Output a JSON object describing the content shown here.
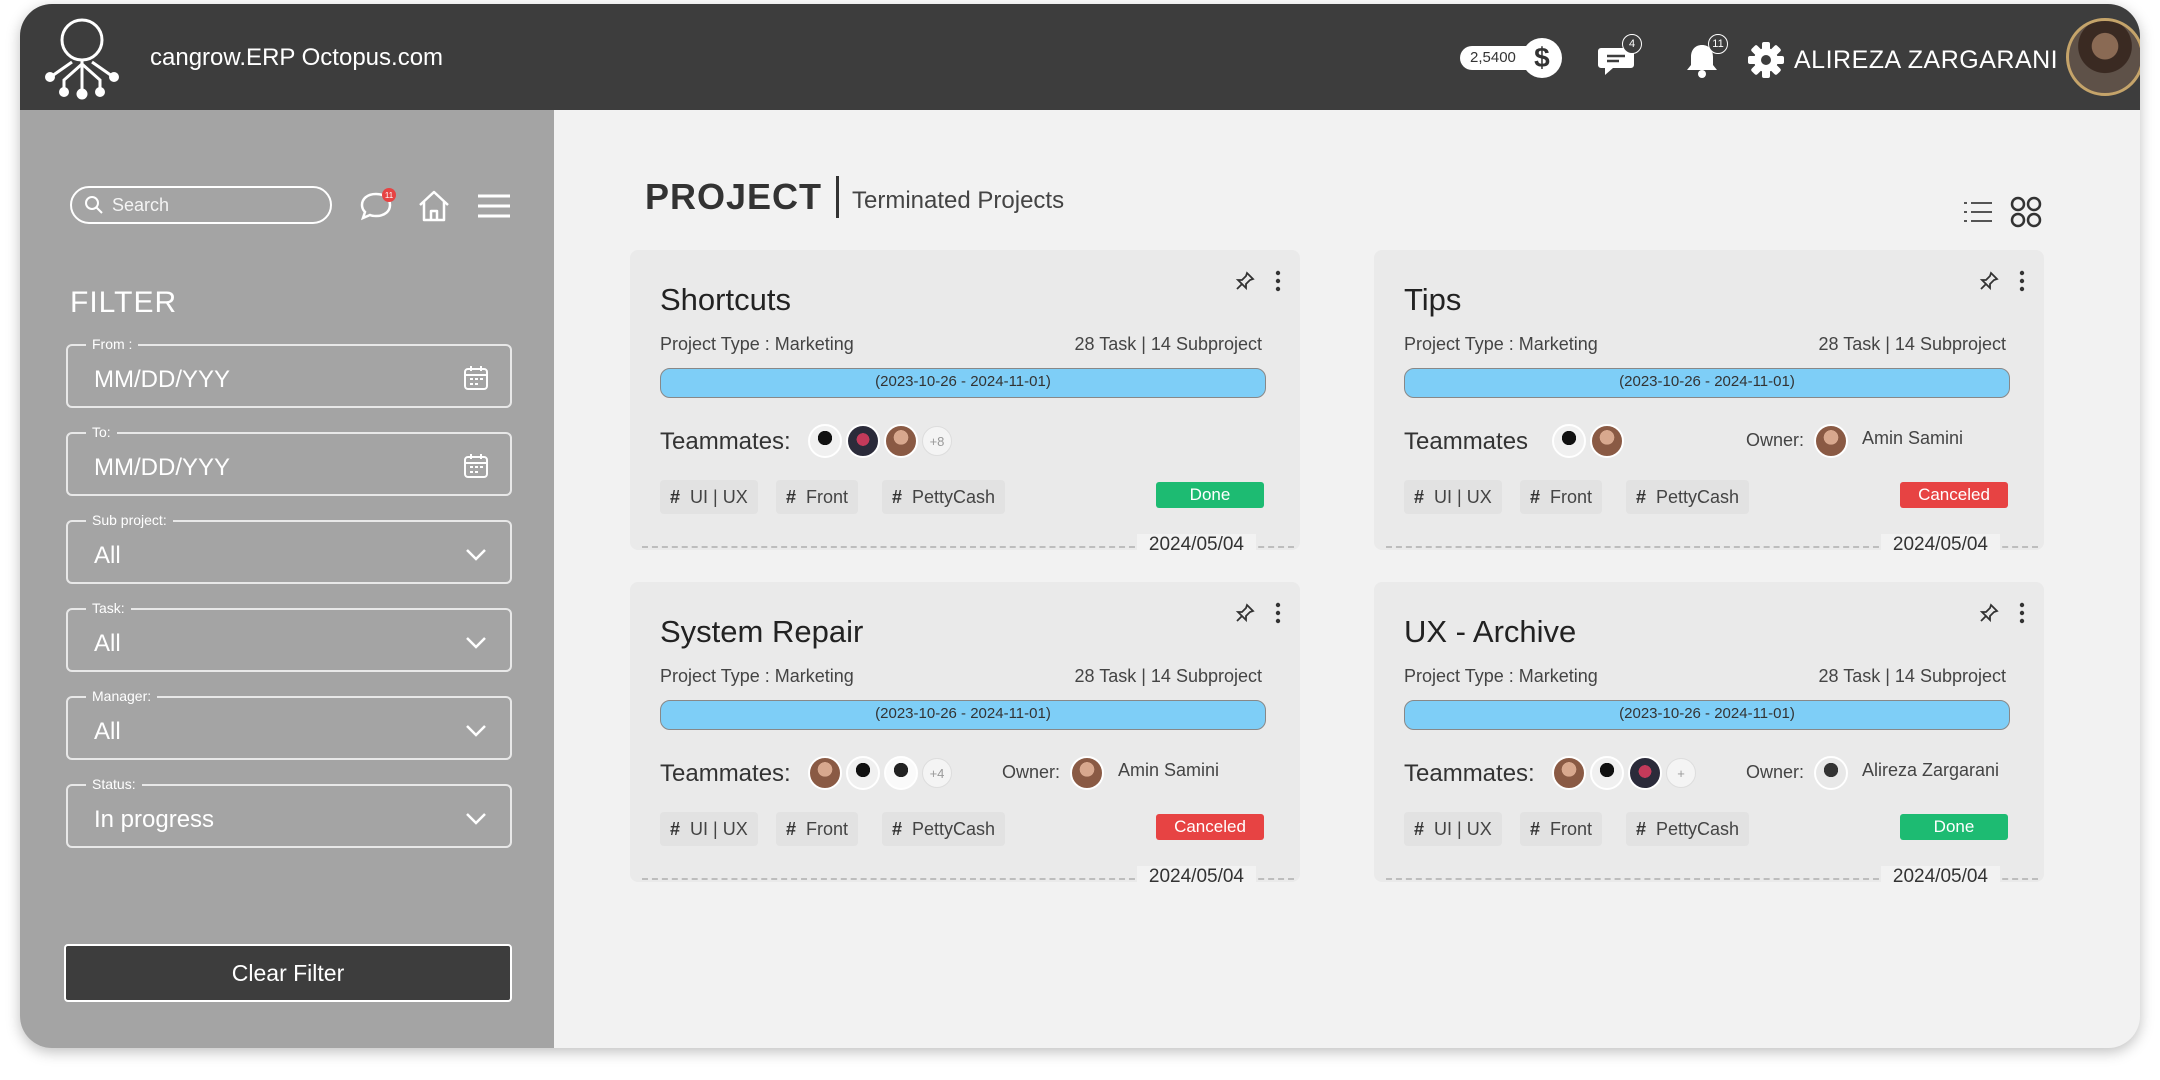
{
  "header": {
    "brand": "cangrow.ERP Octopus.com",
    "coin_balance": "2,5400",
    "coin_symbol": "$",
    "messages_count": "4",
    "notifications_count": "11",
    "username": "ALIREZA ZARGARANI"
  },
  "sidebar": {
    "search_placeholder": "Search",
    "chat_badge": "11",
    "filter_title": "FILTER",
    "fields": [
      {
        "label": "From :",
        "value": "MM/DD/YYY"
      },
      {
        "label": "To:",
        "value": "MM/DD/YYY"
      },
      {
        "label": "Sub project:",
        "value": "All"
      },
      {
        "label": "Task:",
        "value": "All"
      },
      {
        "label": "Manager:",
        "value": "All"
      },
      {
        "label": "Status:",
        "value": "In progress"
      }
    ],
    "clear_button": "Clear Filter"
  },
  "main": {
    "title": "PROJECT",
    "subtitle": "Terminated Projects",
    "cards": [
      {
        "title": "Shortcuts",
        "type": "Project Type : Marketing",
        "count": "28 Task | 14 Subproject",
        "range": "(2023-10-26 - 2024-11-01)",
        "teammates_label": "Teammates:",
        "more": "+8",
        "owner_label": "",
        "owner_name": "",
        "tags": [
          "UI | UX",
          "Front",
          "PettyCash"
        ],
        "status": "Done",
        "date": "2024/05/04"
      },
      {
        "title": "Tips",
        "type": "Project Type : Marketing",
        "count": "28 Task | 14 Subproject",
        "range": "(2023-10-26 - 2024-11-01)",
        "teammates_label": "Teammates",
        "more": "",
        "owner_label": "Owner:",
        "owner_name": "Amin Samini",
        "tags": [
          "UI | UX",
          "Front",
          "PettyCash"
        ],
        "status": "Canceled",
        "date": "2024/05/04"
      },
      {
        "title": "System Repair",
        "type": "Project Type : Marketing",
        "count": "28 Task | 14 Subproject",
        "range": "(2023-10-26 - 2024-11-01)",
        "teammates_label": "Teammates:",
        "more": "+4",
        "owner_label": "Owner:",
        "owner_name": "Amin Samini",
        "tags": [
          "UI | UX",
          "Front",
          "PettyCash"
        ],
        "status": "Canceled",
        "date": "2024/05/04"
      },
      {
        "title": "UX - Archive",
        "type": "Project Type : Marketing",
        "count": "28 Task | 14 Subproject",
        "range": "(2023-10-26 - 2024-11-01)",
        "teammates_label": "Teammates:",
        "more": "+",
        "owner_label": "Owner:",
        "owner_name": "Alireza Zargarani",
        "tags": [
          "UI | UX",
          "Front",
          "PettyCash"
        ],
        "status": "Done",
        "date": "2024/05/04"
      }
    ]
  },
  "colors": {
    "topbar": "#3d3d3d",
    "sidebar": "#a4a4a4",
    "progress": "#7ecef7",
    "done": "#1dbb72",
    "canceled": "#e74343"
  },
  "icons": [
    "logo-octopus-icon",
    "dollar-coin-icon",
    "chat-icon",
    "bell-icon",
    "gear-icon",
    "search-icon",
    "home-icon",
    "menu-icon",
    "calendar-icon",
    "chevron-down-icon",
    "list-view-icon",
    "grid-view-icon",
    "pin-icon",
    "more-vertical-icon"
  ]
}
